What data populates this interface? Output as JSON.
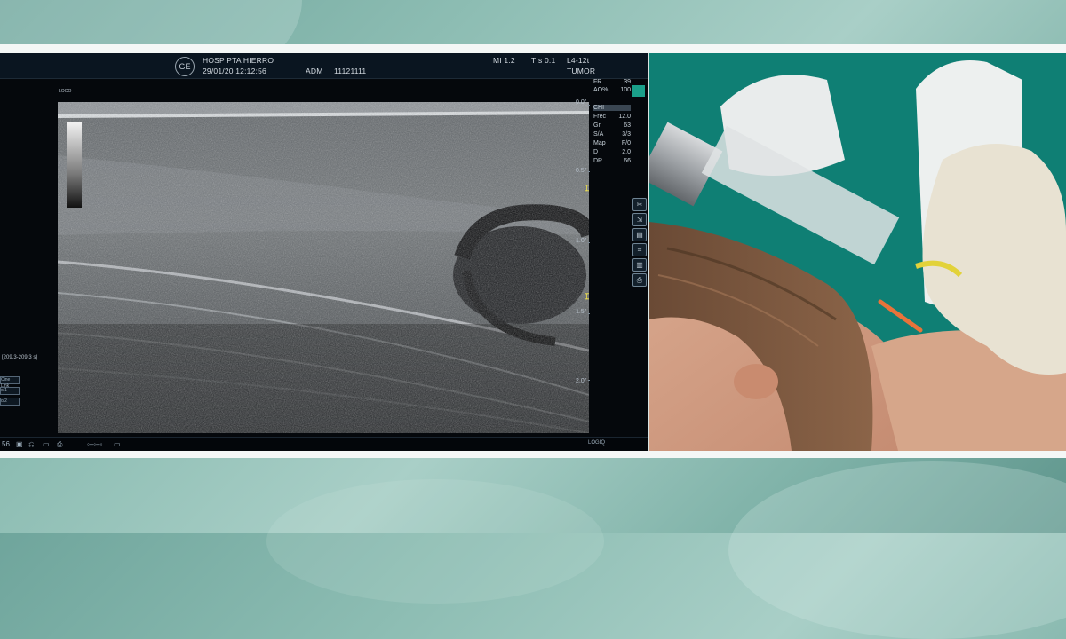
{
  "ultrasound": {
    "header": {
      "hospital": "HOSP PTA HIERRO",
      "datetime": "29/01/20 12:12:56",
      "operator": "ADM",
      "patient_id": "11121111",
      "mi": "MI 1.2",
      "tis": "TIs 0.1",
      "probe": "L4-12t",
      "preset": "TUMOR",
      "logo": "GE"
    },
    "logo_label": "LOGO",
    "params": [
      {
        "key": "FR",
        "value": "39"
      },
      {
        "key": "AO%",
        "value": "100"
      },
      {
        "key": "CHI",
        "value": ""
      },
      {
        "key": "Frec",
        "value": "12.0"
      },
      {
        "key": "Gn",
        "value": "63"
      },
      {
        "key": "S/A",
        "value": "3/3"
      },
      {
        "key": "Map",
        "value": "F/0"
      },
      {
        "key": "D",
        "value": "2.0"
      },
      {
        "key": "DR",
        "value": "66"
      }
    ],
    "depth_labels": [
      "0.0\"",
      "0.5\"",
      "1.0\"",
      "1.5\"",
      "2.0\""
    ],
    "cine_range": "[209.3-209.3 s]",
    "left_buttons": [
      "Cine Link",
      "o/1",
      "o/2"
    ],
    "bottom_left_value": "56",
    "brand": "LOGIQ"
  },
  "colors": {
    "accent_teal": "#1aa08a",
    "marker_yellow": "#f0e24a",
    "surgical_drape": "#0f7f74"
  }
}
